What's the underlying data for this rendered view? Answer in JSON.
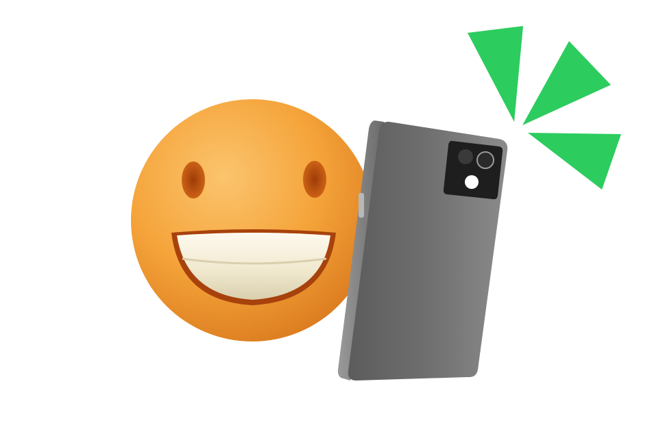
{
  "colors": {
    "background": "#ffffff",
    "burst_green": "#2dcc5f",
    "emoji_orange": "#f5a43a",
    "emoji_shadow": "#d9731b",
    "teeth": "#f4efd8",
    "phone_body": "#6b6b6b",
    "phone_edge": "#8a8a8a",
    "camera_module": "#1e1e1e"
  },
  "icons": {
    "emoji": "grinning-face-icon",
    "phone": "smartphone-icon",
    "burst": "flash-burst-icon"
  }
}
